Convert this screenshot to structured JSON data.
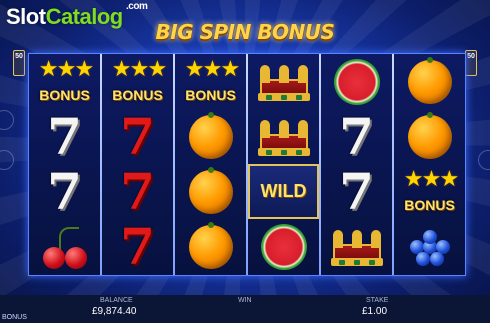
{
  "logo": {
    "left": "Slot",
    "right": "Catalog",
    "suffix": ".com"
  },
  "title": "BIG SPIN BONUS",
  "lines_badge": {
    "left": "50",
    "right": "50"
  },
  "reels": [
    [
      "bonus",
      "seven-white",
      "seven-white",
      "cherries"
    ],
    [
      "bonus",
      "seven-red",
      "seven-red",
      "seven-red"
    ],
    [
      "bonus",
      "orange",
      "orange",
      "orange"
    ],
    [
      "crown",
      "crown",
      "wild",
      "watermelon"
    ],
    [
      "watermelon",
      "seven-white",
      "seven-white",
      "crown"
    ],
    [
      "orange",
      "orange",
      "bonus",
      "grapes"
    ]
  ],
  "symbol_labels": {
    "bonus": "BONUS",
    "wild": "WILD"
  },
  "footer": {
    "balance_label": "BALANCE",
    "balance_value": "£9,874.40",
    "win_label": "WIN",
    "stake_label": "STAKE",
    "stake_value": "£1.00",
    "corner_label": "BONUS"
  },
  "colors": {
    "accent_gold": "#ffd34a",
    "logo_green": "#7fdc1f"
  }
}
